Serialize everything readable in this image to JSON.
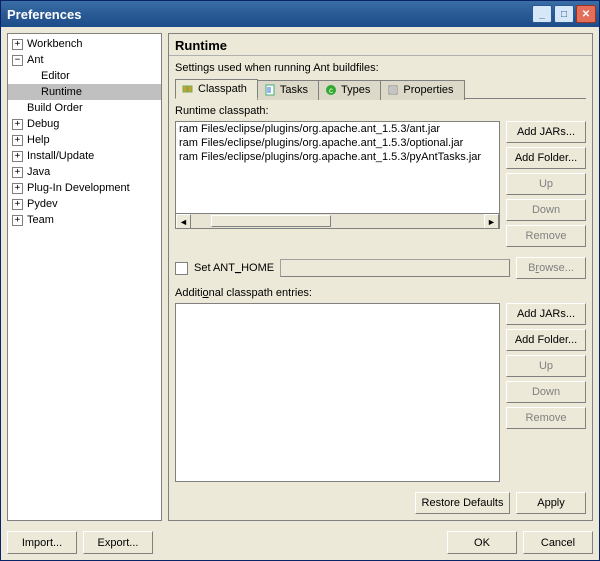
{
  "window": {
    "title": "Preferences"
  },
  "tree": {
    "items": [
      {
        "label": "Workbench",
        "exp": "+",
        "indent": 0
      },
      {
        "label": "Ant",
        "exp": "−",
        "indent": 0
      },
      {
        "label": "Editor",
        "exp": "",
        "indent": 1
      },
      {
        "label": "Runtime",
        "exp": "",
        "indent": 1,
        "selected": true
      },
      {
        "label": "Build Order",
        "exp": "",
        "indent": 0
      },
      {
        "label": "Debug",
        "exp": "+",
        "indent": 0
      },
      {
        "label": "Help",
        "exp": "+",
        "indent": 0
      },
      {
        "label": "Install/Update",
        "exp": "+",
        "indent": 0
      },
      {
        "label": "Java",
        "exp": "+",
        "indent": 0
      },
      {
        "label": "Plug-In Development",
        "exp": "+",
        "indent": 0
      },
      {
        "label": "Pydev",
        "exp": "+",
        "indent": 0
      },
      {
        "label": "Team",
        "exp": "+",
        "indent": 0
      }
    ]
  },
  "panel": {
    "title": "Runtime",
    "subtitle": "Settings used when running Ant buildfiles:",
    "tabs": [
      "Classpath",
      "Tasks",
      "Types",
      "Properties"
    ],
    "runtime_label": "Runtime classpath:",
    "classpath_entries": [
      "ram Files/eclipse/plugins/org.apache.ant_1.5.3/ant.jar",
      "ram Files/eclipse/plugins/org.apache.ant_1.5.3/optional.jar",
      "ram Files/eclipse/plugins/org.apache.ant_1.5.3/pyAntTasks.jar"
    ],
    "buttons1": {
      "add_jars": "Add JARs...",
      "add_folder": "Add Folder...",
      "up": "Up",
      "down": "Down",
      "remove": "Remove"
    },
    "set_ant_home": "Set ANT_HOME",
    "browse": "Browse...",
    "additional_label": "Additional classpath entries:",
    "buttons2": {
      "add_jars": "Add JARs...",
      "add_folder": "Add Folder...",
      "up": "Up",
      "down": "Down",
      "remove": "Remove"
    },
    "restore": "Restore Defaults",
    "apply": "Apply"
  },
  "footer": {
    "import": "Import...",
    "export": "Export...",
    "ok": "OK",
    "cancel": "Cancel"
  }
}
